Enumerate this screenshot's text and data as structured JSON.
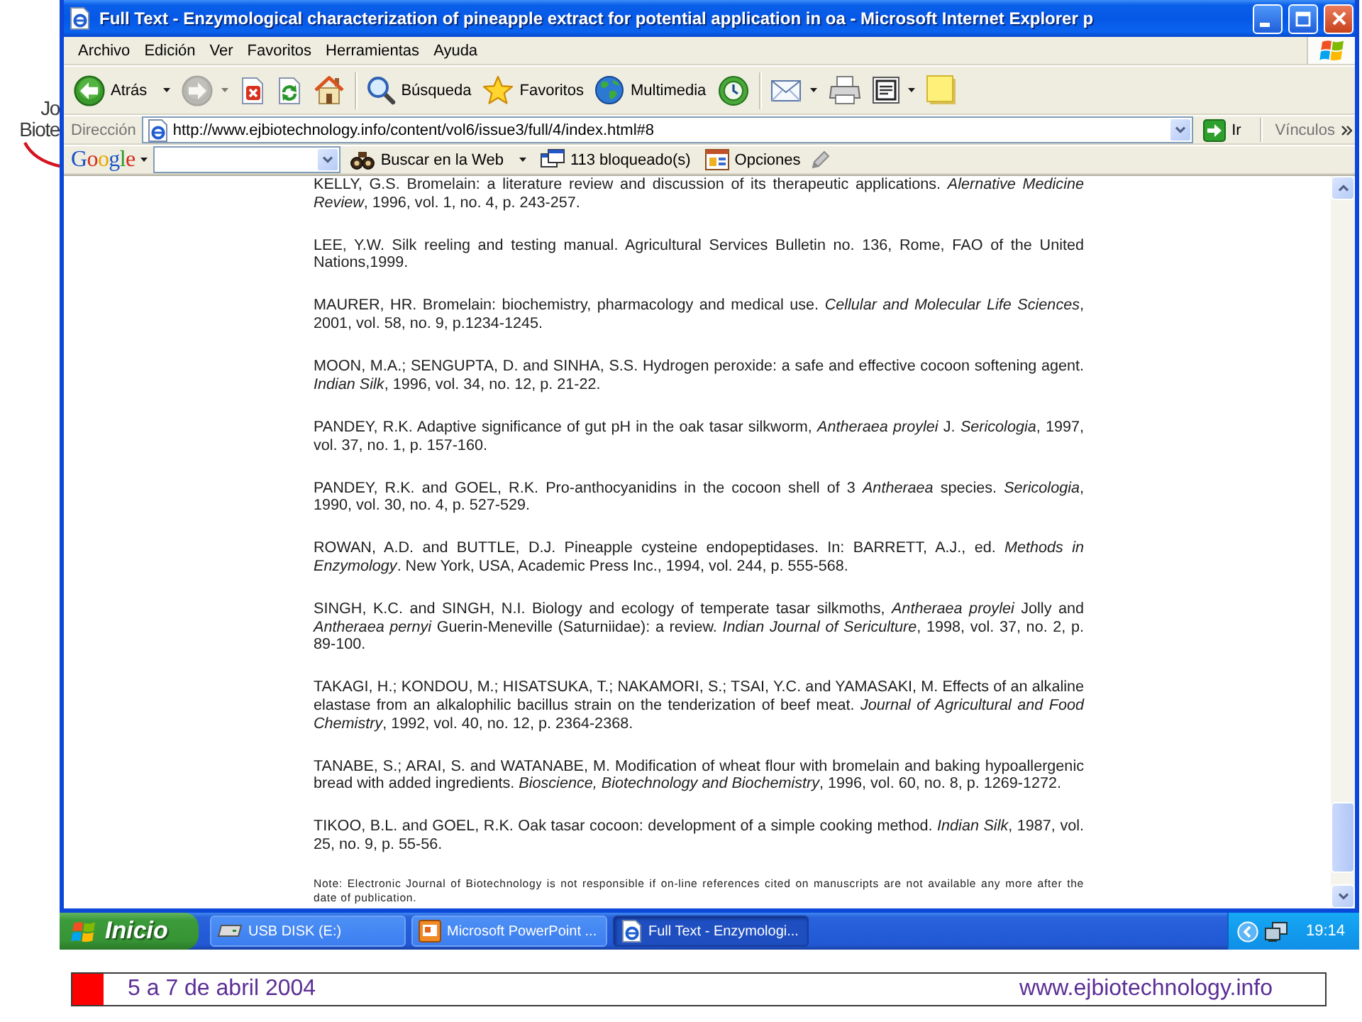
{
  "logo": {
    "lines": [
      "Jo",
      "Biote"
    ]
  },
  "window": {
    "title": "Full Text - Enzymological characterization of pineapple extract for potential application in oa - Microsoft Internet Explorer p"
  },
  "menu": {
    "items": [
      "Archivo",
      "Edición",
      "Ver",
      "Favoritos",
      "Herramientas",
      "Ayuda"
    ]
  },
  "toolbar": {
    "groups": [
      [
        {
          "kind": "back",
          "label": "Atrás",
          "dropdown": true,
          "disabled": false
        },
        {
          "kind": "forward",
          "dropdown": true,
          "disabled": true
        },
        {
          "kind": "stop",
          "dropdown": false,
          "disabled": false
        },
        {
          "kind": "refresh",
          "dropdown": false,
          "disabled": false
        },
        {
          "kind": "home",
          "dropdown": false,
          "disabled": false
        }
      ],
      [
        {
          "kind": "search",
          "label": "Búsqueda",
          "dropdown": false,
          "disabled": false
        },
        {
          "kind": "favorites",
          "label": "Favoritos",
          "dropdown": false,
          "disabled": false
        },
        {
          "kind": "media",
          "label": "Multimedia",
          "dropdown": false,
          "disabled": false
        },
        {
          "kind": "history",
          "dropdown": false,
          "disabled": false
        }
      ],
      [
        {
          "kind": "mail",
          "dropdown": true,
          "disabled": false
        },
        {
          "kind": "print",
          "dropdown": false,
          "disabled": false
        },
        {
          "kind": "edit",
          "dropdown": true,
          "disabled": false
        },
        {
          "kind": "note",
          "dropdown": false,
          "disabled": false
        }
      ]
    ]
  },
  "address_bar": {
    "label": "Dirección",
    "value": "http://www.ejbiotechnology.info/content/vol6/issue3/full/4/index.html#8",
    "go_label": "Ir",
    "links_label": "Vínculos"
  },
  "google_bar": {
    "logo": "Google",
    "search_label": "Buscar en la Web",
    "blocked_label": "113 bloqueado(s)",
    "options_label": "Opciones"
  },
  "page": {
    "references": [
      "KELLY, G.S. Bromelain: a literature review and discussion of its therapeutic applications. *Alernative Medicine Review*, 1996, vol. 1, no. 4, p. 243-257.",
      "LEE, Y.W. Silk reeling and testing manual. Agricultural Services Bulletin no. 136, Rome, FAO of the United Nations,1999.",
      "MAURER, HR. Bromelain: biochemistry, pharmacology and medical use. *Cellular and Molecular Life Sciences*, 2001, vol. 58, no. 9, p.1234-1245.",
      "MOON, M.A.; SENGUPTA, D. and SINHA, S.S. Hydrogen peroxide: a safe and effective cocoon softening agent. *Indian Silk*, 1996, vol. 34, no. 12, p. 21-22.",
      "PANDEY, R.K. Adaptive significance of gut pH in the oak tasar silkworm, *Antheraea proylei* J. *Sericologia*, 1997, vol. 37, no. 1, p. 157-160.",
      "PANDEY, R.K. and GOEL, R.K. Pro-anthocyanidins in the cocoon shell of 3 *Antheraea* species. *Sericologia*, 1990, vol. 30, no. 4, p. 527-529.",
      "ROWAN, A.D. and BUTTLE, D.J. Pineapple cysteine endopeptidases. In: BARRETT, A.J., ed. *Methods in Enzymology*. New York, USA, Academic Press Inc., 1994, vol. 244, p. 555-568.",
      "SINGH, K.C. and SINGH, N.I. Biology and ecology of temperate tasar silkmoths, *Antheraea proylei* Jolly and *Antheraea pernyi* Guerin-Meneville (Saturniidae): a review. *Indian Journal of Sericulture*, 1998, vol. 37, no. 2, p. 89-100.",
      "TAKAGI, H.; KONDOU, M.; HISATSUKA, T.; NAKAMORI, S.; TSAI, Y.C. and YAMASAKI, M. Effects of an alkaline elastase from an alkalophilic bacillus strain on the tenderization of beef meat. *Journal of Agricultural and Food Chemistry*, 1992, vol. 40, no. 12, p. 2364-2368.",
      "TANABE, S.; ARAI, S. and WATANABE, M. Modification of wheat flour with bromelain and baking hypoallergenic bread with added ingredients. *Bioscience, Biotechnology and Biochemistry*, 1996, vol. 60, no. 8, p. 1269-1272.",
      "TIKOO, B.L. and GOEL, R.K. Oak tasar cocoon: development of a simple cooking method. *Indian Silk*, 1987, vol. 25, no. 9, p. 55-56."
    ],
    "note": "Note: Electronic Journal of Biotechnology is not responsible if on-line references cited on manuscripts are not available any more after the date of publication."
  },
  "taskbar": {
    "start_label": "Inicio",
    "tasks": [
      {
        "kind": "drive",
        "label": "USB DISK (E:)",
        "selected": false
      },
      {
        "kind": "presentation",
        "label": "Microsoft PowerPoint ...",
        "selected": false
      },
      {
        "kind": "browser",
        "label": "Full Text - Enzymologi...",
        "selected": true
      }
    ],
    "clock": "19:14"
  },
  "footer": {
    "date": "5 a 7 de abril 2004",
    "url": "www.ejbiotechnology.info"
  }
}
